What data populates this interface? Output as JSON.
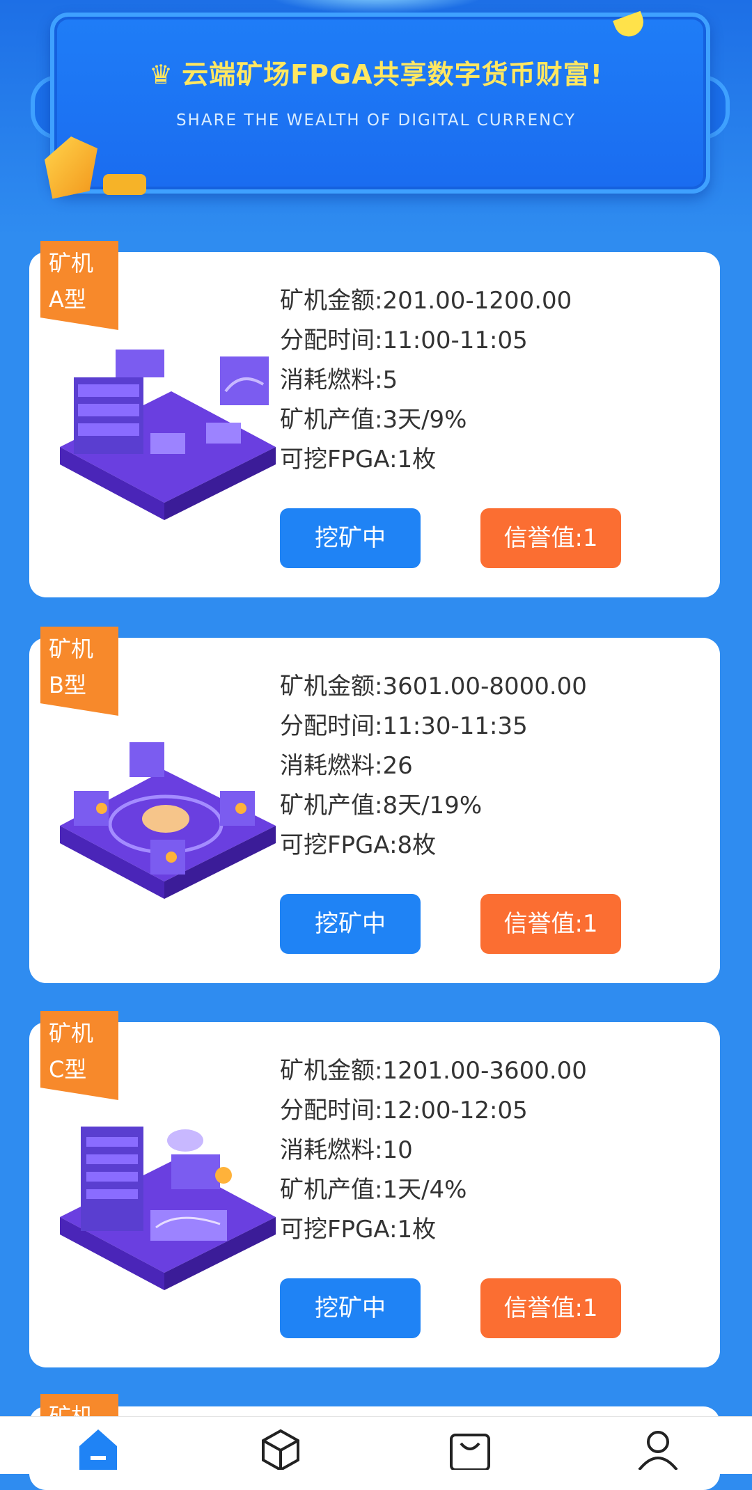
{
  "banner": {
    "title": "云端矿场FPGA共享数字货币财富!",
    "subtitle": "SHARE THE WEALTH OF DIGITAL CURRENCY",
    "icon": "crown-icon"
  },
  "labels": {
    "amount": "矿机金额:",
    "time": "分配时间:",
    "fuel": "消耗燃料:",
    "output": "矿机产值:",
    "mineable": "可挖FPGA:"
  },
  "machines": [
    {
      "ribbon_line1": "矿机",
      "ribbon_line2": "A型",
      "amount": "201.00-1200.00",
      "time": "11:00-11:05",
      "fuel": "5",
      "output": "3天/9%",
      "mineable": "1枚",
      "action_label": "挖矿中",
      "credit_label": "信誉值:1"
    },
    {
      "ribbon_line1": "矿机",
      "ribbon_line2": "B型",
      "amount": "3601.00-8000.00",
      "time": "11:30-11:35",
      "fuel": "26",
      "output": "8天/19%",
      "mineable": "8枚",
      "action_label": "挖矿中",
      "credit_label": "信誉值:1"
    },
    {
      "ribbon_line1": "矿机",
      "ribbon_line2": "C型",
      "amount": "1201.00-3600.00",
      "time": "12:00-12:05",
      "fuel": "10",
      "output": "1天/4%",
      "mineable": "1枚",
      "action_label": "挖矿中",
      "credit_label": "信誉值:1"
    }
  ],
  "peek_ribbon": "矿机",
  "tabbar": {
    "items": [
      {
        "icon": "home-icon",
        "active": true
      },
      {
        "icon": "cube-icon",
        "active": false
      },
      {
        "icon": "bag-icon",
        "active": false
      },
      {
        "icon": "user-icon",
        "active": false
      }
    ]
  },
  "colors": {
    "background": "#2f8cf0",
    "banner_title": "#ffe761",
    "ribbon": "#f7892b",
    "primary_button": "#1f83f5",
    "credit_button": "#fb6e32"
  }
}
